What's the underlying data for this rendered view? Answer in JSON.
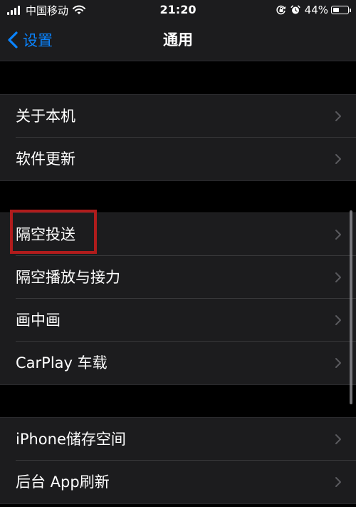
{
  "status_bar": {
    "carrier": "中国移动",
    "time": "21:20",
    "battery_percent": "44%",
    "battery_level": 0.44,
    "icons": [
      "signal-icon",
      "wifi-icon",
      "orientation-lock-icon",
      "alarm-icon",
      "battery-icon"
    ]
  },
  "nav": {
    "back_label": "设置",
    "title": "通用"
  },
  "groups": [
    {
      "items": [
        {
          "label": "关于本机"
        },
        {
          "label": "软件更新"
        }
      ]
    },
    {
      "items": [
        {
          "label": "隔空投送"
        },
        {
          "label": "隔空播放与接力"
        },
        {
          "label": "画中画"
        },
        {
          "label": "CarPlay 车载"
        }
      ]
    },
    {
      "items": [
        {
          "label": "iPhone储存空间"
        },
        {
          "label": "后台 App刷新"
        }
      ]
    }
  ],
  "annotation": {
    "highlighted_item": "隔空投送",
    "highlight_color": "#b01c1c"
  },
  "colors": {
    "background": "#000000",
    "cell_background": "#1c1c1e",
    "accent": "#0a84ff",
    "chevron": "#5a5a5e"
  }
}
